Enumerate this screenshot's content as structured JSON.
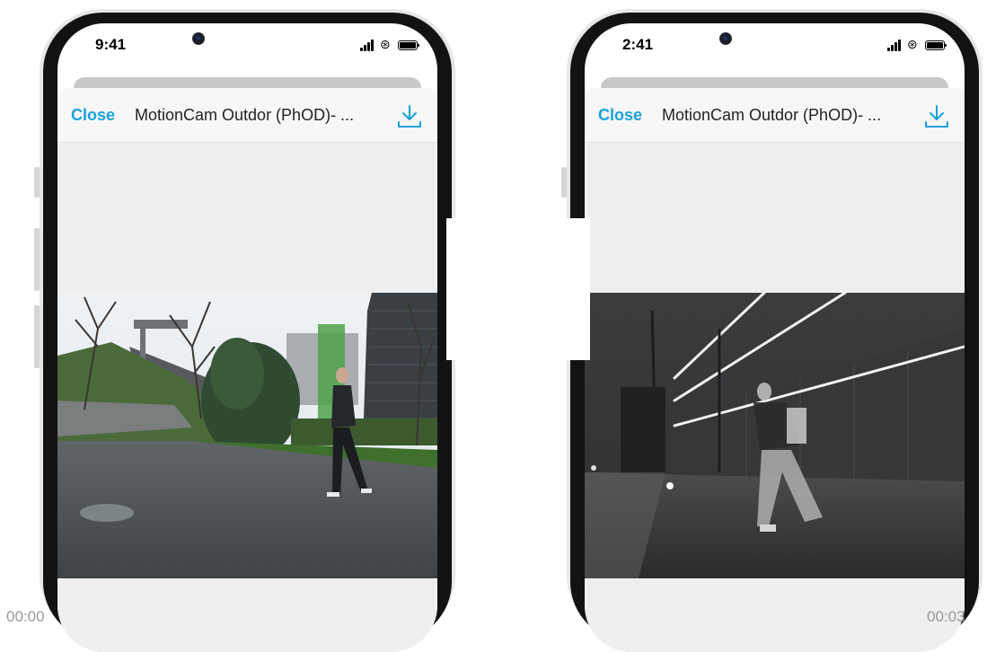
{
  "left_phone": {
    "status_time": "9:41",
    "close_label": "Close",
    "title": "MotionCam Outdor (PhOD)- ...",
    "download_icon": "download-icon",
    "scene": "daytime-courtyard"
  },
  "right_phone": {
    "status_time": "2:41",
    "close_label": "Close",
    "title": "MotionCam Outdor (PhOD)- ...",
    "download_icon": "download-icon",
    "scene": "night-infrared-street"
  },
  "timeline": {
    "start_label": "00:00",
    "end_label": "00:03"
  },
  "colors": {
    "accent": "#1aa0dc",
    "sheet": "#efefef",
    "navbar": "#f7f7f7"
  }
}
